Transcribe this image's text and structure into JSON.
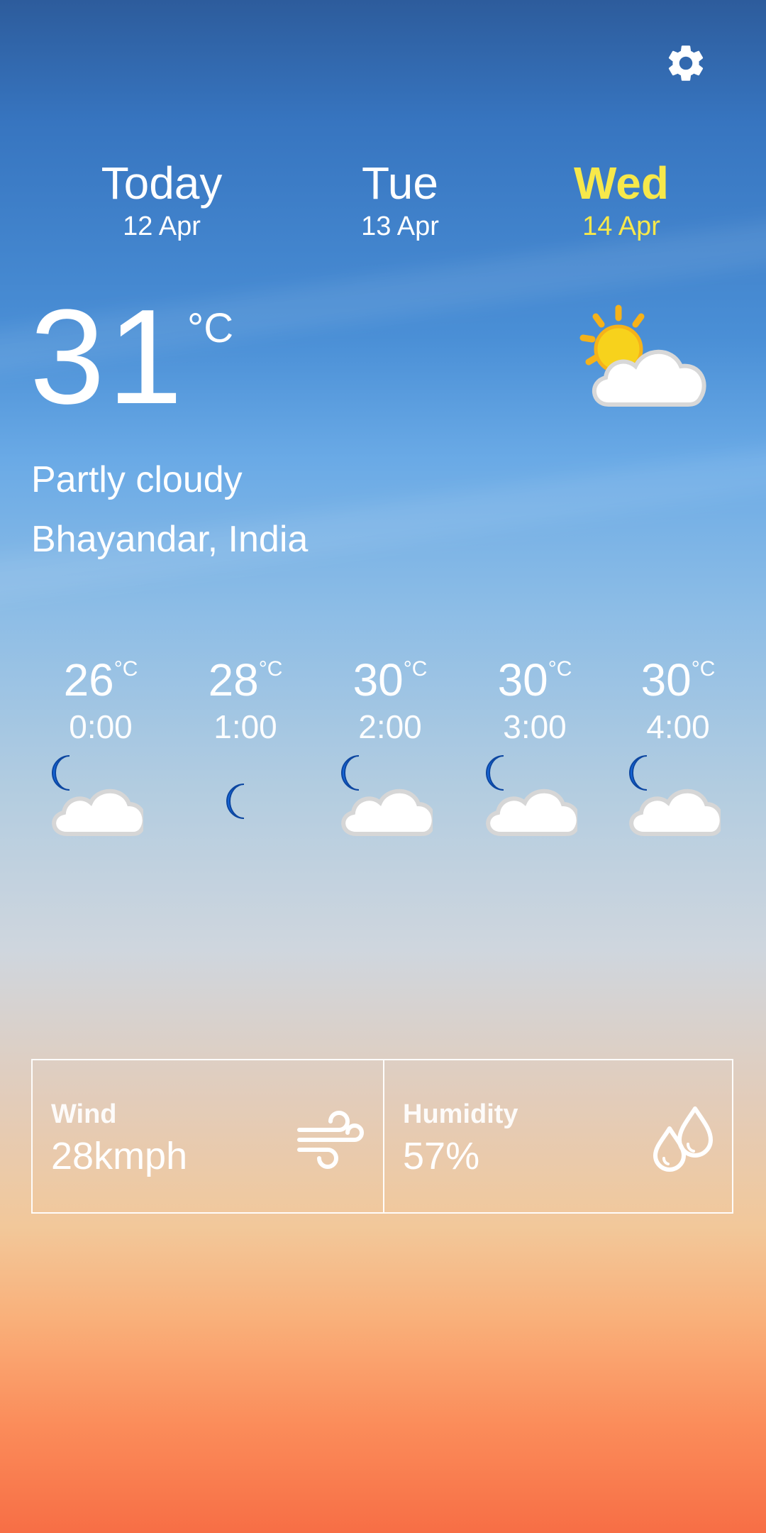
{
  "days": [
    {
      "name": "Today",
      "date": "12 Apr"
    },
    {
      "name": "Tue",
      "date": "13 Apr"
    },
    {
      "name": "Wed",
      "date": "14 Apr"
    }
  ],
  "selected_day": "Wed",
  "current": {
    "temperature": "31",
    "unit": "°C",
    "condition": "Partly cloudy",
    "location": "Bhayandar, India",
    "icon": "partly-sunny-icon"
  },
  "hourly": [
    {
      "temp": "26",
      "unit": "°C",
      "time": "0:00",
      "icon": "night-cloudy-icon"
    },
    {
      "temp": "28",
      "unit": "°C",
      "time": "1:00",
      "icon": "moon-icon"
    },
    {
      "temp": "30",
      "unit": "°C",
      "time": "2:00",
      "icon": "night-cloudy-icon"
    },
    {
      "temp": "30",
      "unit": "°C",
      "time": "3:00",
      "icon": "night-cloudy-icon"
    },
    {
      "temp": "30",
      "unit": "°C",
      "time": "4:00",
      "icon": "night-cloudy-icon"
    }
  ],
  "stats": {
    "wind": {
      "label": "Wind",
      "value": "28kmph",
      "icon": "wind-icon"
    },
    "humidity": {
      "label": "Humidity",
      "value": "57%",
      "icon": "humidity-drops-icon"
    }
  },
  "colors": {
    "selected_day": "#f7e84a",
    "moon": "#1565d8",
    "sun": "#f5c518"
  }
}
